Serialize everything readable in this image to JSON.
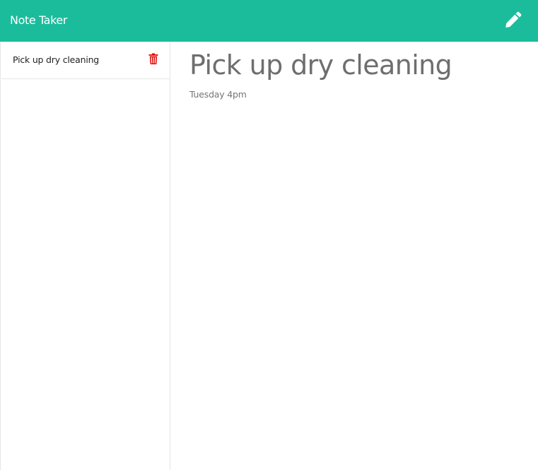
{
  "header": {
    "brand": "Note Taker",
    "new_note_icon": "pencil-icon"
  },
  "sidebar": {
    "notes": [
      {
        "title": "Pick up dry cleaning",
        "delete_icon": "trash-icon"
      }
    ]
  },
  "active_note": {
    "title": "Pick up dry cleaning",
    "text": "Tuesday 4pm"
  },
  "colors": {
    "navbar": "#1abc9c",
    "delete_icon": "#e00000",
    "title_text": "#6e6e6e"
  }
}
